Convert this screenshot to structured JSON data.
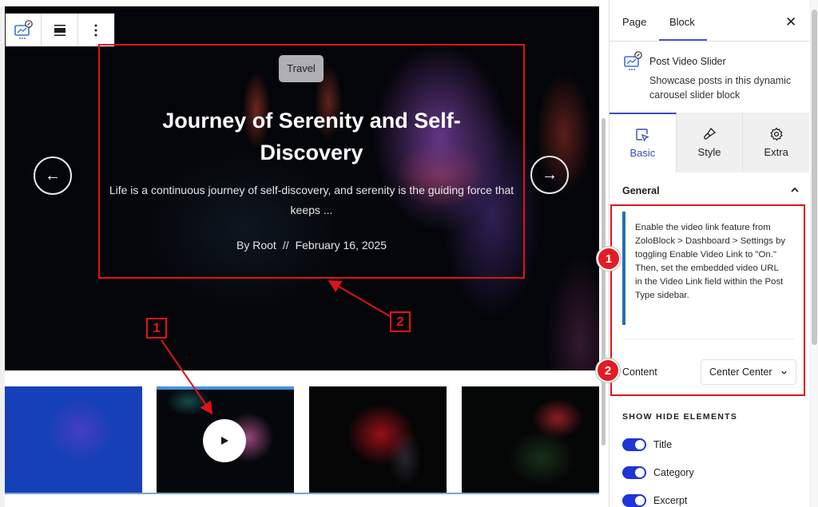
{
  "block_toolbar": {
    "items": [
      {
        "icon": "post-video-slider-icon",
        "label": "Post Video Slider block"
      },
      {
        "icon": "align-icon",
        "label": "Align"
      },
      {
        "icon": "more-options-icon",
        "label": "Options"
      }
    ]
  },
  "slider": {
    "category": "Travel",
    "title": "Journey of Serenity and Self-Discovery",
    "excerpt": "Life is a continuous journey of self-discovery, and serenity is the guiding force that keeps ...",
    "author": "By Root",
    "separator": "//",
    "date": "February 16, 2025",
    "prev_icon": "←",
    "next_icon": "→",
    "thumbnails": [
      {
        "label": "thumbnail-1",
        "active": false,
        "has_play": false
      },
      {
        "label": "thumbnail-2",
        "active": true,
        "has_play": true
      },
      {
        "label": "thumbnail-3",
        "active": false,
        "has_play": false
      },
      {
        "label": "thumbnail-4",
        "active": false,
        "has_play": false
      }
    ]
  },
  "annotations": {
    "canvas_labels": [
      "1",
      "2"
    ],
    "sidebar_badges": [
      "1",
      "2"
    ],
    "colors": {
      "annotation": "#e0121a"
    }
  },
  "sidebar": {
    "tabs": [
      {
        "label": "Page",
        "active": false
      },
      {
        "label": "Block",
        "active": true
      }
    ],
    "close_icon": "✕",
    "block": {
      "name": "Post Video Slider",
      "description": "Showcase posts in this dynamic carousel slider block"
    },
    "panel_tabs": [
      {
        "label": "Basic",
        "icon": "cursor-select-icon",
        "active": true
      },
      {
        "label": "Style",
        "icon": "brush-icon",
        "active": false
      },
      {
        "label": "Extra",
        "icon": "gear-icon",
        "active": false
      }
    ],
    "general": {
      "title": "General",
      "notice": "Enable the video link feature from ZoloBlock > Dashboard > Settings by toggling Enable Video Link to \"On.\" Then, set the embedded video URL in the Video Link field within the Post Type sidebar.",
      "content_label": "Content",
      "content_value": "Center Center"
    },
    "show_hide": {
      "title": "SHOW HIDE ELEMENTS",
      "toggles": [
        {
          "label": "Title",
          "on": true
        },
        {
          "label": "Category",
          "on": true
        },
        {
          "label": "Excerpt",
          "on": true
        }
      ]
    },
    "colors": {
      "accent": "#3a4bb8",
      "toggle": "#1e34d8",
      "notice_border": "#2271b1"
    }
  }
}
